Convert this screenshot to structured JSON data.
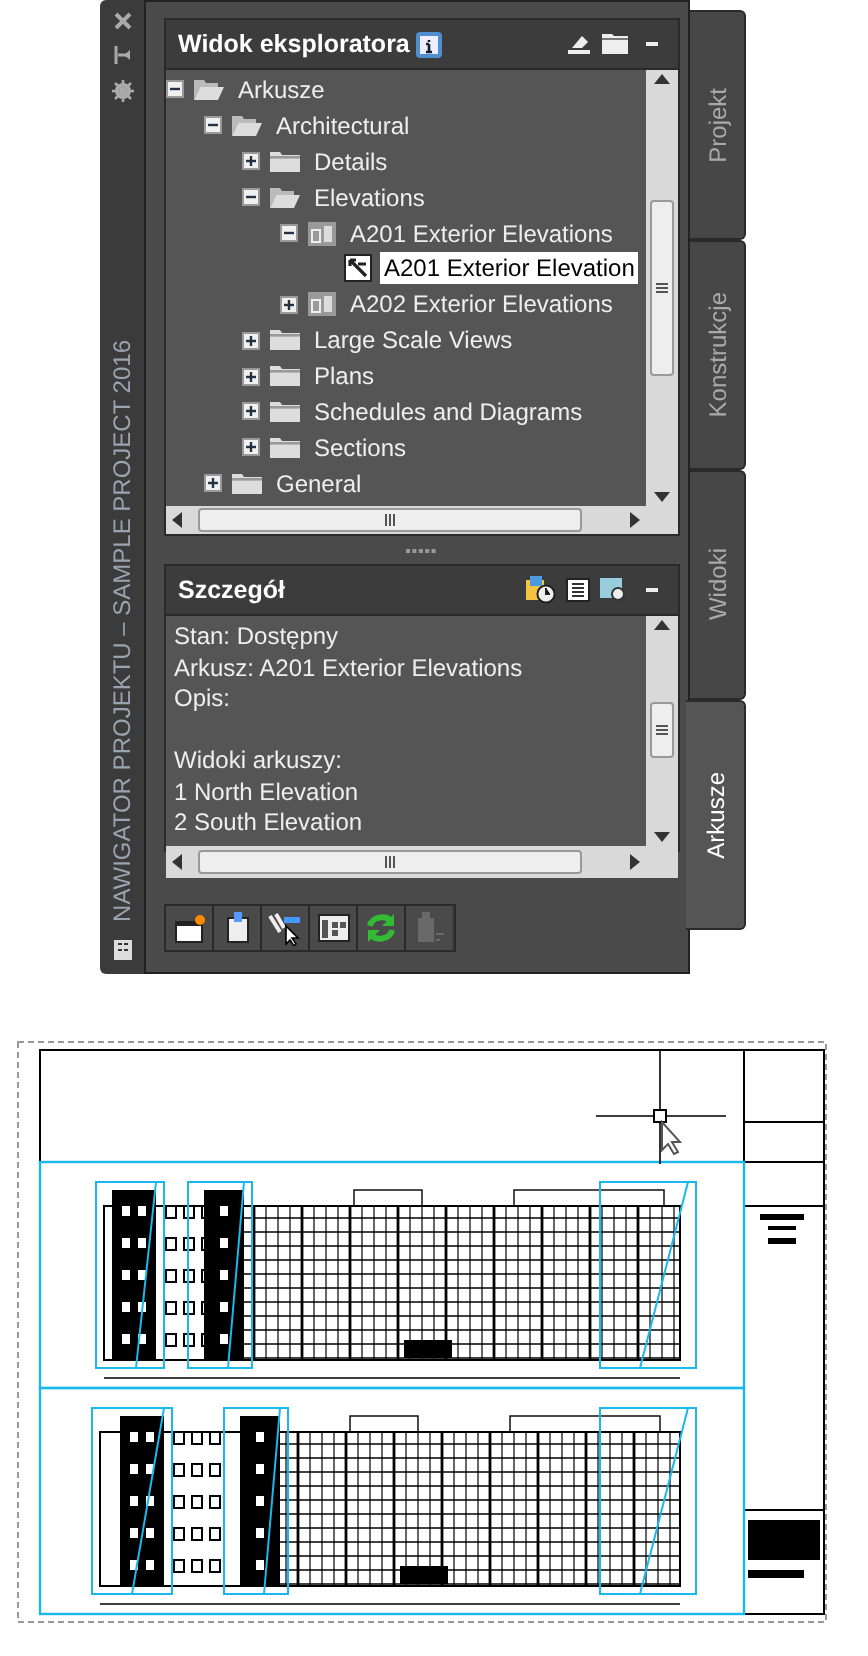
{
  "palette": {
    "title": "NAWIGATOR PROJEKTU – SAMPLE PROJECT 2016",
    "explorer": {
      "title": "Widok eksploratora",
      "tree": [
        {
          "label": "Arkusze",
          "kind": "folder",
          "expanded": true,
          "selected": false,
          "children": [
            {
              "label": "Architectural",
              "kind": "folder",
              "expanded": true,
              "selected": false,
              "children": [
                {
                  "label": "Details",
                  "kind": "folder",
                  "expanded": false,
                  "selected": false
                },
                {
                  "label": "Elevations",
                  "kind": "folder",
                  "expanded": true,
                  "selected": false,
                  "children": [
                    {
                      "label": "A201 Exterior Elevations",
                      "kind": "sheet",
                      "expanded": true,
                      "selected": false,
                      "children": [
                        {
                          "label": "A201 Exterior Elevation",
                          "kind": "view",
                          "selected": true
                        }
                      ]
                    },
                    {
                      "label": "A202 Exterior Elevations",
                      "kind": "sheet",
                      "expanded": false,
                      "selected": false
                    }
                  ]
                },
                {
                  "label": "Large Scale Views",
                  "kind": "folder",
                  "expanded": false,
                  "selected": false
                },
                {
                  "label": "Plans",
                  "kind": "folder",
                  "expanded": false,
                  "selected": false
                },
                {
                  "label": "Schedules and Diagrams",
                  "kind": "folder",
                  "expanded": false,
                  "selected": false
                },
                {
                  "label": "Sections",
                  "kind": "folder",
                  "expanded": false,
                  "selected": false
                }
              ]
            },
            {
              "label": "General",
              "kind": "folder",
              "expanded": false,
              "selected": false
            }
          ]
        }
      ]
    },
    "details": {
      "title": "Szczegół",
      "paragraphs": [
        [
          "Stan: Dostępny",
          "Arkusz: A201 Exterior Elevations",
          "Opis:"
        ],
        [
          "Widoki arkuszy:",
          "1 North Elevation",
          "2 South Elevation"
        ]
      ]
    },
    "toolbar": [
      {
        "disabled": false
      },
      {
        "disabled": false
      },
      {
        "disabled": false
      },
      {
        "disabled": false
      },
      {
        "disabled": false
      },
      {
        "disabled": true
      }
    ],
    "tabs": [
      {
        "label": "Projekt",
        "selected": false
      },
      {
        "label": "Konstrukcje",
        "selected": false
      },
      {
        "label": "Widoki",
        "selected": false
      },
      {
        "label": "Arkusze",
        "selected": true
      }
    ]
  }
}
